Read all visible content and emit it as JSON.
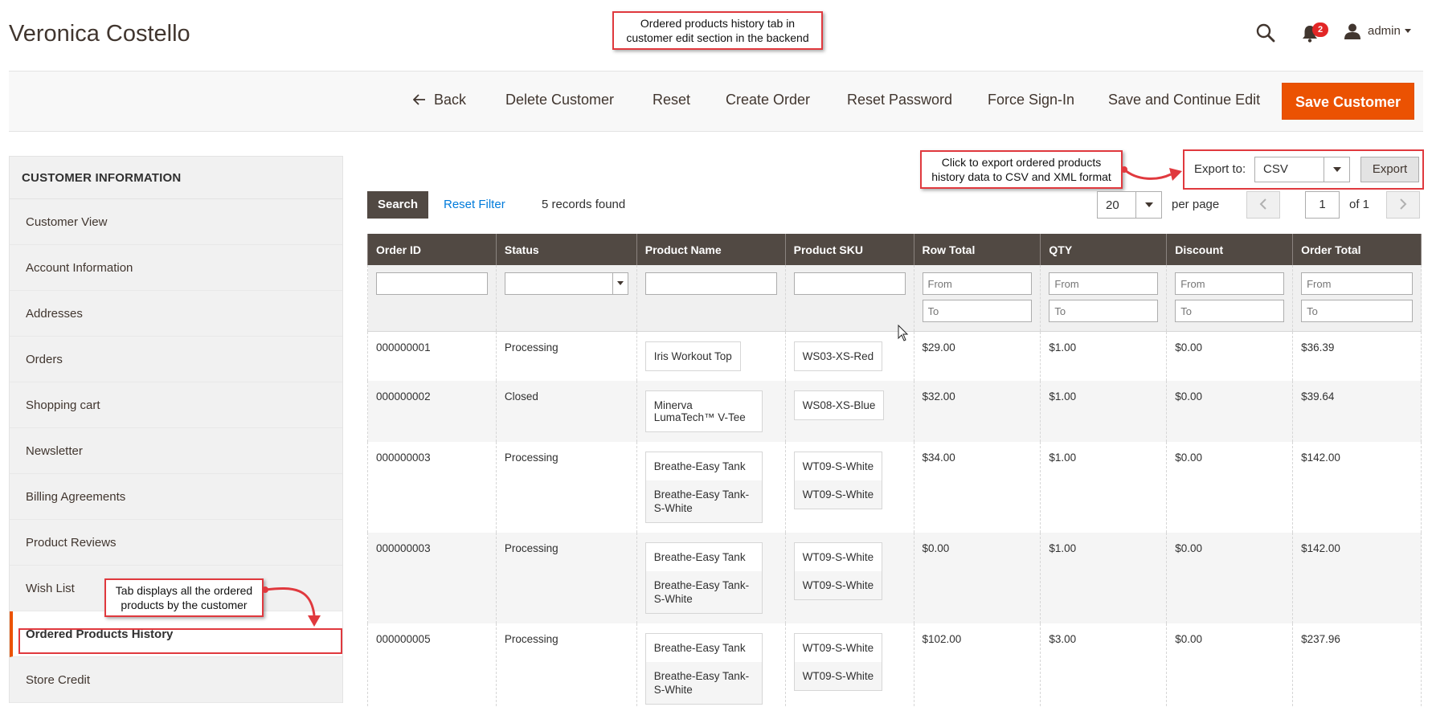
{
  "page": {
    "title": "Veronica Costello"
  },
  "header": {
    "notification_count": "2",
    "user_name": "admin"
  },
  "toolbar": {
    "back": "Back",
    "delete": "Delete Customer",
    "reset": "Reset",
    "create_order": "Create Order",
    "reset_password": "Reset Password",
    "force_signin": "Force Sign-In",
    "save_continue": "Save and Continue Edit",
    "save": "Save Customer"
  },
  "sidebar": {
    "heading": "CUSTOMER INFORMATION",
    "items": [
      "Customer View",
      "Account Information",
      "Addresses",
      "Orders",
      "Shopping cart",
      "Newsletter",
      "Billing Agreements",
      "Product Reviews",
      "Wish List",
      "Ordered Products History",
      "Store Credit"
    ]
  },
  "export": {
    "label": "Export to:",
    "selected": "CSV",
    "button": "Export"
  },
  "grid_controls": {
    "search": "Search",
    "reset_filter": "Reset Filter",
    "records": "5 records found",
    "per_page_value": "20",
    "per_page_label": "per page",
    "page": "1",
    "of": "of 1"
  },
  "grid": {
    "columns": [
      "Order ID",
      "Status",
      "Product Name",
      "Product SKU",
      "Row Total",
      "QTY",
      "Discount",
      "Order Total"
    ],
    "from_placeholder": "From",
    "to_placeholder": "To",
    "rows": [
      {
        "order_id": "000000001",
        "status": "Processing",
        "products": [
          "Iris Workout Top"
        ],
        "skus": [
          "WS03-XS-Red"
        ],
        "row_total": "$29.00",
        "qty": "$1.00",
        "discount": "$0.00",
        "order_total": "$36.39"
      },
      {
        "order_id": "000000002",
        "status": "Closed",
        "products": [
          "Minerva LumaTech™ V-Tee"
        ],
        "skus": [
          "WS08-XS-Blue"
        ],
        "row_total": "$32.00",
        "qty": "$1.00",
        "discount": "$0.00",
        "order_total": "$39.64"
      },
      {
        "order_id": "000000003",
        "status": "Processing",
        "products": [
          "Breathe-Easy Tank",
          "Breathe-Easy Tank-S-White"
        ],
        "skus": [
          "WT09-S-White",
          "WT09-S-White"
        ],
        "row_total": "$34.00",
        "qty": "$1.00",
        "discount": "$0.00",
        "order_total": "$142.00"
      },
      {
        "order_id": "000000003",
        "status": "Processing",
        "products": [
          "Breathe-Easy Tank",
          "Breathe-Easy Tank-S-White"
        ],
        "skus": [
          "WT09-S-White",
          "WT09-S-White"
        ],
        "row_total": "$0.00",
        "qty": "$1.00",
        "discount": "$0.00",
        "order_total": "$142.00"
      },
      {
        "order_id": "000000005",
        "status": "Processing",
        "products": [
          "Breathe-Easy Tank",
          "Breathe-Easy Tank-S-White"
        ],
        "skus": [
          "WT09-S-White",
          "WT09-S-White"
        ],
        "row_total": "$102.00",
        "qty": "$3.00",
        "discount": "$0.00",
        "order_total": "$237.96"
      }
    ]
  },
  "callouts": {
    "top": "Ordered products history tab in customer edit section in the backend",
    "export": "Click to export ordered products history data to CSV and XML format",
    "sidebar": "Tab displays all the ordered products by the customer"
  },
  "colors": {
    "accent": "#eb5202",
    "header_bg": "#514943",
    "link": "#007bdb",
    "callout_border": "#e0393e"
  }
}
